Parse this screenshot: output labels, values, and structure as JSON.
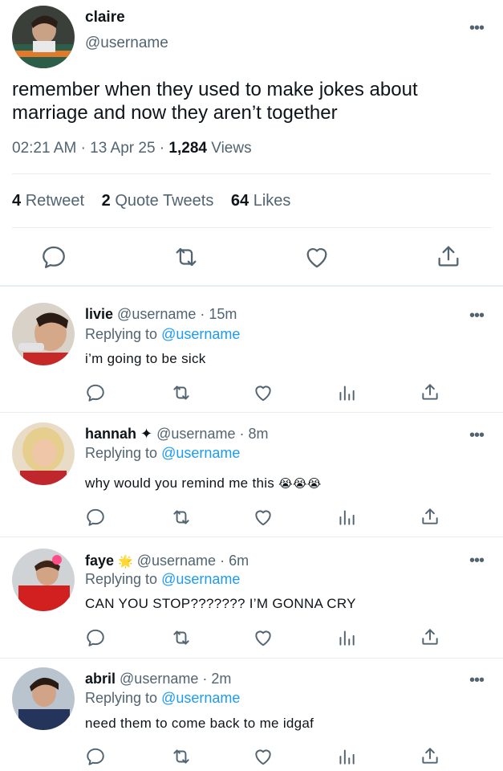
{
  "main_tweet": {
    "name": "claire",
    "handle": "@username",
    "text": "remember when they used to make jokes about marriage and now they aren’t together",
    "time": "02:21 AM",
    "dot1": "·",
    "date": "13 Apr 25",
    "dot2": "·",
    "views_count": "1,284",
    "views_label": "Views",
    "retweet_count": "4",
    "retweet_label": "Retweet",
    "quote_count": "2",
    "quote_label": "Quote Tweets",
    "likes_count": "64",
    "likes_label": "Likes",
    "more": "•••"
  },
  "replies": [
    {
      "name": "livie",
      "badge": "",
      "handle": "@username",
      "dot": "·",
      "time": "15m",
      "replying_prefix": "Replying to",
      "replying_mention": "@username",
      "text": "i’m going to be sick",
      "more": "•••"
    },
    {
      "name": "hannah",
      "badge": "✦",
      "handle": "@username",
      "dot": "·",
      "time": "8m",
      "replying_prefix": "Replying to",
      "replying_mention": "@username",
      "text": "why would you remind me this",
      "emoji_text": "😭😭😭",
      "more": "•••"
    },
    {
      "name": "faye",
      "badge": "🌟",
      "handle": "@username",
      "dot": "·",
      "time": "6m",
      "replying_prefix": "Replying to",
      "replying_mention": "@username",
      "text": "CAN YOU STOP??????? I’M GONNA CRY",
      "more": "•••"
    },
    {
      "name": "abril",
      "badge": "",
      "handle": "@username",
      "dot": "·",
      "time": "2m",
      "replying_prefix": "Replying to",
      "replying_mention": "@username",
      "text": "need them to come back to me idgaf",
      "more": "•••"
    }
  ],
  "colors": {
    "accent": "#1d9bf0",
    "secondary_text": "#536471",
    "primary_text": "#0f1419",
    "divider": "#e6ecf0"
  },
  "icons": [
    "reply-icon",
    "retweet-icon",
    "like-icon",
    "share-icon",
    "analytics-icon",
    "more-icon"
  ]
}
